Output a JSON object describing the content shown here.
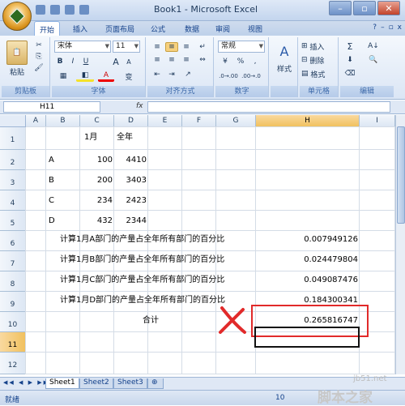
{
  "window": {
    "title": "Book1 - Microsoft Excel",
    "minimize": "–",
    "restore": "▫",
    "close": "✕"
  },
  "tabs": [
    "开始",
    "插入",
    "页面布局",
    "公式",
    "数据",
    "审阅",
    "视图"
  ],
  "ribbon": {
    "clipboard": {
      "paste": "粘贴",
      "label": "剪贴板"
    },
    "font": {
      "name": "宋体",
      "size": "11",
      "bold": "B",
      "italic": "I",
      "underline": "U",
      "grow": "A",
      "shrink": "A",
      "font_color": "A",
      "phonetic": "变",
      "label": "字体"
    },
    "alignment": {
      "label": "对齐方式"
    },
    "number": {
      "format": "常规",
      "percent": "%",
      "comma": ",",
      "label": "数字"
    },
    "styles": {
      "styles": "样式"
    },
    "cells": {
      "insert": "插入",
      "delete": "删除",
      "format": "格式",
      "label": "单元格"
    },
    "editing": {
      "sigma": "Σ",
      "label": "编辑"
    }
  },
  "formula_bar": {
    "name_box": "H11",
    "fx": "fx",
    "value": ""
  },
  "columns": [
    "A",
    "B",
    "C",
    "D",
    "E",
    "F",
    "G",
    "H",
    "I"
  ],
  "active_column": "H",
  "rows": [
    "1",
    "2",
    "3",
    "4",
    "5",
    "6",
    "7",
    "8",
    "9",
    "10",
    "11",
    "12"
  ],
  "active_row": "11",
  "cells": {
    "c1": "1月",
    "d1": "全年",
    "b2": "A",
    "c2": "100",
    "d2": "4410",
    "b3": "B",
    "c3": "200",
    "d3": "3403",
    "b4": "C",
    "c4": "234",
    "d4": "2423",
    "b5": "D",
    "c5": "432",
    "d5": "2344",
    "b6": "计算1月A部门的产量占全年所有部门的百分比",
    "h6": "0.007949126",
    "b7": "计算1月B部门的产量占全年所有部门的百分比",
    "h7": "0.024479804",
    "b8": "计算1月C部门的产量占全年所有部门的百分比",
    "h8": "0.049087476",
    "b9": "计算1月D部门的产量占全年所有部门的百分比",
    "h9": "0.184300341",
    "e10": "合计",
    "h10": "0.265816747"
  },
  "sheets": [
    "Sheet1",
    "Sheet2",
    "Sheet3"
  ],
  "active_sheet": "Sheet1",
  "status": {
    "ready": "就绪",
    "zoom": "10"
  },
  "annotation": {
    "mark_color": "#e12a2a"
  },
  "watermark": {
    "line1": "jb51.net",
    "line2": "脚本之家"
  }
}
